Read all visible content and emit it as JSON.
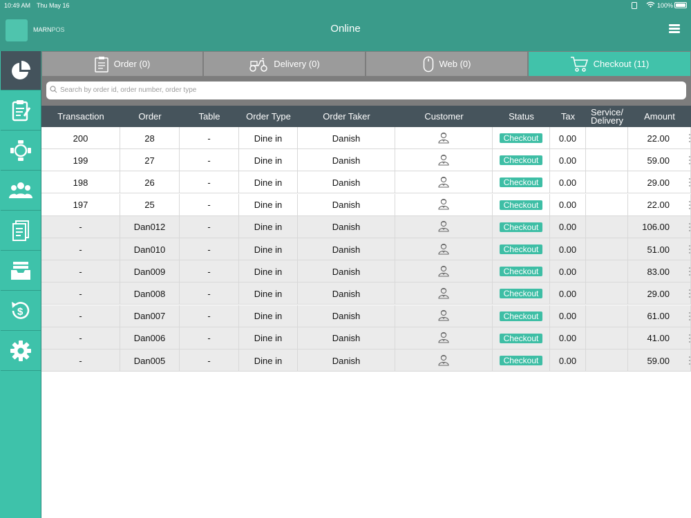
{
  "status_bar": {
    "time": "10:49 AM",
    "date": "Thu May 16",
    "battery": "100%"
  },
  "header": {
    "logo_bold": "MARN",
    "logo_thin": "POS",
    "title": "Online"
  },
  "sidebar": {
    "items": [
      {
        "icon": "pie-chart-icon"
      },
      {
        "icon": "clipboard-icon"
      },
      {
        "icon": "table-chairs-icon"
      },
      {
        "icon": "users-icon"
      },
      {
        "icon": "receipt-icon"
      },
      {
        "icon": "inbox-tray-icon"
      },
      {
        "icon": "refund-icon"
      },
      {
        "icon": "gear-icon"
      }
    ]
  },
  "tabs": [
    {
      "label": "Order (0)",
      "icon": "order-list-icon"
    },
    {
      "label": "Delivery (0)",
      "icon": "scooter-icon"
    },
    {
      "label": "Web (0)",
      "icon": "mouse-icon"
    },
    {
      "label": "Checkout (11)",
      "icon": "cart-icon"
    }
  ],
  "search": {
    "placeholder": "Search by order id, order number, order type"
  },
  "table": {
    "columns": [
      "Transaction",
      "Order",
      "Table",
      "Order Type",
      "Order Taker",
      "Customer",
      "Status",
      "Tax",
      "Service/ Delivery",
      "Amount"
    ],
    "rows": [
      {
        "transaction": "200",
        "order": "28",
        "table": "-",
        "type": "Dine in",
        "taker": "Danish",
        "status": "Checkout",
        "tax": "0.00",
        "service": "",
        "amount": "22.00"
      },
      {
        "transaction": "199",
        "order": "27",
        "table": "-",
        "type": "Dine in",
        "taker": "Danish",
        "status": "Checkout",
        "tax": "0.00",
        "service": "",
        "amount": "59.00"
      },
      {
        "transaction": "198",
        "order": "26",
        "table": "-",
        "type": "Dine in",
        "taker": "Danish",
        "status": "Checkout",
        "tax": "0.00",
        "service": "",
        "amount": "29.00"
      },
      {
        "transaction": "197",
        "order": "25",
        "table": "-",
        "type": "Dine in",
        "taker": "Danish",
        "status": "Checkout",
        "tax": "0.00",
        "service": "",
        "amount": "22.00"
      },
      {
        "transaction": "-",
        "order": "Dan012",
        "table": "-",
        "type": "Dine in",
        "taker": "Danish",
        "status": "Checkout",
        "tax": "0.00",
        "service": "",
        "amount": "106.00"
      },
      {
        "transaction": "-",
        "order": "Dan010",
        "table": "-",
        "type": "Dine in",
        "taker": "Danish",
        "status": "Checkout",
        "tax": "0.00",
        "service": "",
        "amount": "51.00"
      },
      {
        "transaction": "-",
        "order": "Dan009",
        "table": "-",
        "type": "Dine in",
        "taker": "Danish",
        "status": "Checkout",
        "tax": "0.00",
        "service": "",
        "amount": "83.00"
      },
      {
        "transaction": "-",
        "order": "Dan008",
        "table": "-",
        "type": "Dine in",
        "taker": "Danish",
        "status": "Checkout",
        "tax": "0.00",
        "service": "",
        "amount": "29.00"
      },
      {
        "transaction": "-",
        "order": "Dan007",
        "table": "-",
        "type": "Dine in",
        "taker": "Danish",
        "status": "Checkout",
        "tax": "0.00",
        "service": "",
        "amount": "61.00"
      },
      {
        "transaction": "-",
        "order": "Dan006",
        "table": "-",
        "type": "Dine in",
        "taker": "Danish",
        "status": "Checkout",
        "tax": "0.00",
        "service": "",
        "amount": "41.00"
      },
      {
        "transaction": "-",
        "order": "Dan005",
        "table": "-",
        "type": "Dine in",
        "taker": "Danish",
        "status": "Checkout",
        "tax": "0.00",
        "service": "",
        "amount": "59.00"
      }
    ]
  },
  "colors": {
    "header": "#3a9b8a",
    "sidebar": "#3ec2aa",
    "accent": "#41c2aa",
    "table_header": "#46545c"
  }
}
